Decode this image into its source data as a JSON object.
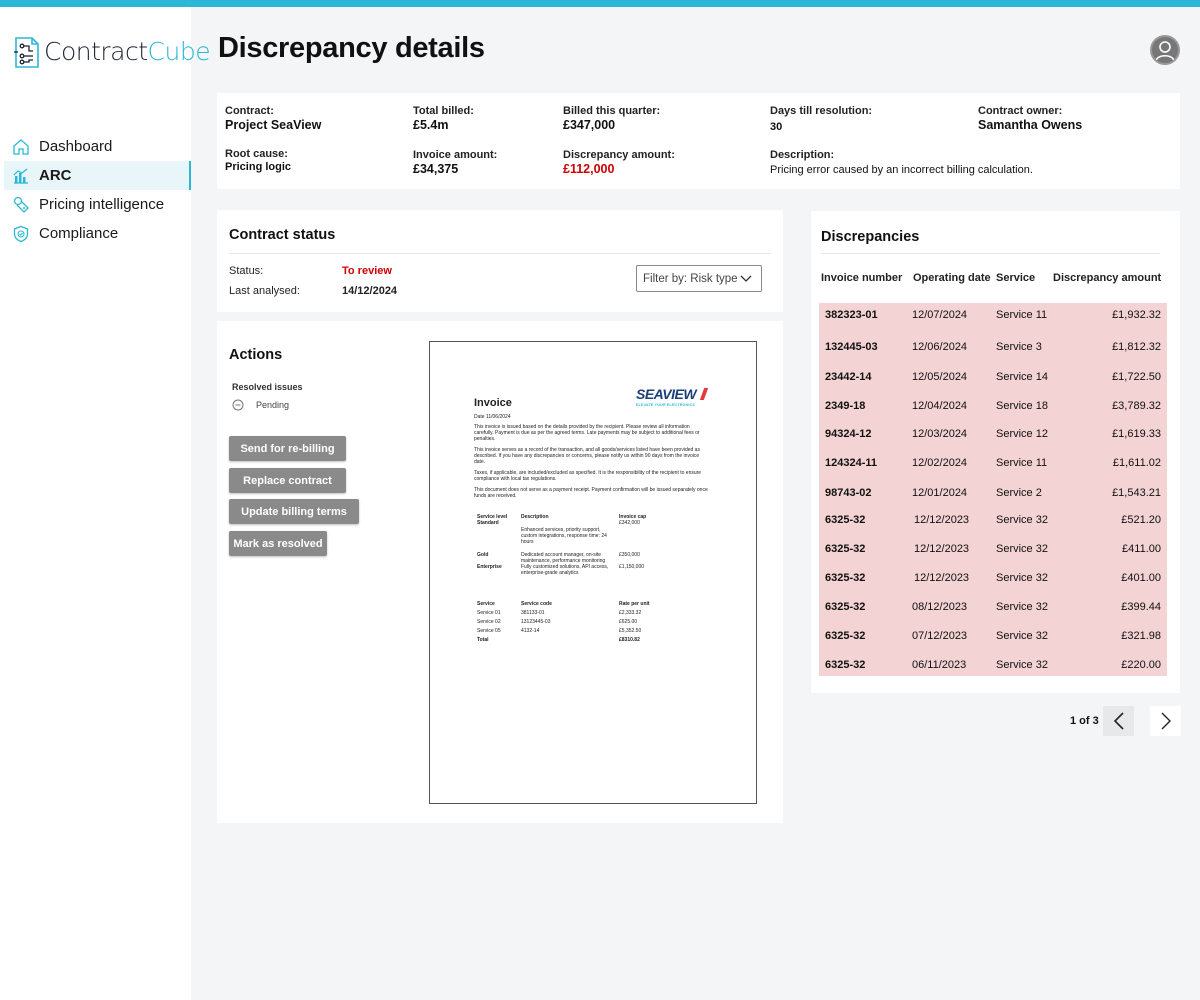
{
  "app": {
    "logo_part1": "Contract",
    "logo_part2": "Cube",
    "accent": "#2bb8d6"
  },
  "sidebar": {
    "items": [
      {
        "label": "Dashboard",
        "icon": "home-icon"
      },
      {
        "label": "ARC",
        "icon": "chart-icon",
        "active": true
      },
      {
        "label": "Pricing intelligence",
        "icon": "price-tag-icon"
      },
      {
        "label": "Compliance",
        "icon": "shield-icon"
      }
    ]
  },
  "page": {
    "title": "Discrepancy details"
  },
  "summary": {
    "contract_label": "Contract:",
    "contract_value": "Project SeaView",
    "total_billed_label": "Total billed:",
    "total_billed_value": "£5.4m",
    "billed_quarter_label": "Billed this quarter:",
    "billed_quarter_value": "£347,000",
    "days_label": "Days till resolution:",
    "days_value": "30",
    "owner_label": "Contract owner:",
    "owner_value": "Samantha Owens",
    "root_cause_label": "Root cause:",
    "root_cause_value": "Pricing logic",
    "invoice_amount_label": "Invoice amount:",
    "invoice_amount_value": "£34,375",
    "discrepancy_amount_label": "Discrepancy amount:",
    "discrepancy_amount_value": "£112,000",
    "description_label": "Description:",
    "description_value": "Pricing error caused by an incorrect billing calculation."
  },
  "contract_status": {
    "title": "Contract status",
    "status_label": "Status:",
    "status_value": "To review",
    "status_color": "#d00000",
    "last_analysed_label": "Last analysed:",
    "last_analysed_value": "14/12/2024",
    "filter_label": "Filter by: Risk type"
  },
  "actions": {
    "title": "Actions",
    "resolved_label": "Resolved issues",
    "pending_label": "Pending",
    "buttons": [
      "Send for re-billing",
      "Replace contract",
      "Update billing terms",
      "Mark as resolved"
    ]
  },
  "invoice_doc": {
    "title": "Invoice",
    "brand": "SEAVIEW",
    "brand_tagline": "ELEVATE YOUR ELECTRONICS",
    "date": "Date 11/06/2024",
    "para1": "This invoice is issued based on the details provided by the recipient. Please review all information carefully. Payment is due as per the agreed terms. Late payments may be subject to additional fees or penalties.",
    "para2": "This invoice serves as a record of the transaction, and all goods/services listed have been provided as described. If you have any discrepancies or concerns, please notify us within 90 days from the invoice date.",
    "para3": "Taxes, if applicable, are included/excluded as specified. It is the responsibility of the recipient to ensure compliance with local tax regulations.",
    "para4": "This document does not serve as a payment receipt. Payment confirmation will be issued separately once funds are received.",
    "t1_headers": [
      "Service level",
      "Description",
      "Invoice cap"
    ],
    "t1_rows": [
      {
        "level": "Standard",
        "desc": "Enhanced services, priority support, custom integrations, response time: 24 hours",
        "cap": "£342,000"
      },
      {
        "level": "Gold",
        "desc": "Dedicated account manager, on-site maintenance, performance monitoring",
        "cap": "£350,000"
      },
      {
        "level": "Enterprise",
        "desc": "Fully customized solutions, API access, enterprise-grade analytics",
        "cap": "£1,150,000"
      }
    ],
    "t2_headers": [
      "Service",
      "Service code",
      "Rate per unit"
    ],
    "t2_rows": [
      {
        "service": "Service 01",
        "code": "381133-01",
        "rate": "£2,333.32"
      },
      {
        "service": "Service 02",
        "code": "13123445-03",
        "rate": "£625.00"
      },
      {
        "service": "Service 05",
        "code": "4132-14",
        "rate": "£5,352.50"
      }
    ],
    "total_label": "Total",
    "total_value": "£8310.82"
  },
  "discrepancies": {
    "title": "Discrepancies",
    "headers": [
      "Invoice number",
      "Operating date",
      "Service",
      "Discrepancy amount"
    ],
    "row_bg": "#f3d3d4",
    "rows": [
      {
        "invoice": "382323-01",
        "date": "12/07/2024",
        "service": "Service 11",
        "amount": "£1,932.32"
      },
      {
        "invoice": "132445-03",
        "date": "12/06/2024",
        "service": "Service 3",
        "amount": "£1,812.32"
      },
      {
        "invoice": "23442-14",
        "date": "12/05/2024",
        "service": "Service 14",
        "amount": "£1,722.50"
      },
      {
        "invoice": "2349-18",
        "date": "12/04/2024",
        "service": "Service 18",
        "amount": "£3,789.32"
      },
      {
        "invoice": "94324-12",
        "date": "12/03/2024",
        "service": "Service 12",
        "amount": "£1,619.33"
      },
      {
        "invoice": "124324-11",
        "date": "12/02/2024",
        "service": "Service 11",
        "amount": "£1,611.02"
      },
      {
        "invoice": "98743-02",
        "date": "12/01/2024",
        "service": "Service 2",
        "amount": "£1,543.21"
      },
      {
        "invoice": "6325-32",
        "date": "12/12/2023",
        "service": "Service 32",
        "amount": "£521.20"
      },
      {
        "invoice": "6325-32",
        "date": "12/12/2023",
        "service": "Service 32",
        "amount": "£411.00"
      },
      {
        "invoice": "6325-32",
        "date": "12/12/2023",
        "service": "Service 32",
        "amount": "£401.00"
      },
      {
        "invoice": "6325-32",
        "date": "08/12/2023",
        "service": "Service 32",
        "amount": "£399.44"
      },
      {
        "invoice": "6325-32",
        "date": "07/12/2023",
        "service": "Service 32",
        "amount": "£321.98"
      },
      {
        "invoice": "6325-32",
        "date": "06/11/2023",
        "service": "Service 32",
        "amount": "£220.00"
      }
    ],
    "pagination": "1 of 3"
  }
}
